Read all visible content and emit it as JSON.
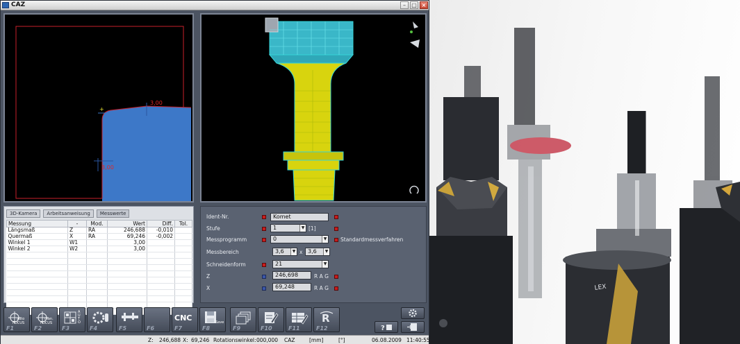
{
  "window": {
    "title": "CAZ"
  },
  "view2d": {
    "dim_top": "3,00",
    "dim_left": "3,00"
  },
  "tabs": [
    {
      "label": "3D-Kamera"
    },
    {
      "label": "Arbeitsanweisung"
    },
    {
      "label": "Messwerte"
    }
  ],
  "table": {
    "headers": [
      "Messung",
      "-",
      "Mod.",
      "Wert",
      "Diff.",
      "Tol."
    ],
    "rows": [
      {
        "messung": "Längsmaß",
        "axis": "Z",
        "mod": "RA",
        "wert": "246,688",
        "diff": "-0,010",
        "tol": ""
      },
      {
        "messung": "Quermaß",
        "axis": "X",
        "mod": "RA",
        "wert": "69,246",
        "diff": "-0,002",
        "tol": ""
      },
      {
        "messung": "Winkel 1",
        "axis": "W1",
        "mod": "",
        "wert": "3,00",
        "diff": "",
        "tol": ""
      },
      {
        "messung": "Winkel 2",
        "axis": "W2",
        "mod": "",
        "wert": "3,00",
        "diff": "",
        "tol": ""
      }
    ]
  },
  "params": {
    "ident_label": "Ident-Nr.",
    "ident_value": "Komet",
    "stufe_label": "Stufe",
    "stufe_value": "1",
    "stufe_count": "[1]",
    "messprogramm_label": "Messprogramm",
    "messprogramm_value": "0",
    "messprogramm_text": "Standardmessverfahren",
    "messbereich_label": "Messbereich",
    "messbereich_a": "3,6",
    "messbereich_x": "x",
    "messbereich_b": "3,6",
    "schneidenform_label": "Schneidenform",
    "schneidenform_value": "21",
    "z_label": "Z",
    "z_value": "246,698",
    "z_rag": "R A G",
    "x_label": "X",
    "x_value": "69,248",
    "x_rag": "R A G"
  },
  "fkeys": [
    {
      "label": "F1",
      "sub1": "auto",
      "sub2": "FOCUS",
      "icon": "crosshair-icon"
    },
    {
      "label": "F2",
      "sub1": "man.",
      "sub2": "FOCUS",
      "icon": "crosshair-icon"
    },
    {
      "label": "F3",
      "sub1": "A U T O",
      "sub2": "",
      "icon": "grid-icon"
    },
    {
      "label": "F4",
      "sub1": "",
      "sub2": "",
      "icon": "tool-insert-icon"
    },
    {
      "label": "F5",
      "sub1": "",
      "sub2": "",
      "icon": "caliper-icon"
    },
    {
      "label": "F6",
      "sub1": "",
      "sub2": "",
      "icon": ""
    },
    {
      "label": "F7",
      "sub1": "CNC",
      "sub2": "",
      "icon": "cnc-icon"
    },
    {
      "label": "F8",
      "sub1": "Save",
      "sub2": "",
      "icon": "save-icon"
    },
    {
      "label": "F9",
      "sub1": "",
      "sub2": "",
      "icon": "layers-icon"
    },
    {
      "label": "F10",
      "sub1": "",
      "sub2": "",
      "icon": "edit-icon"
    },
    {
      "label": "F11",
      "sub1": "",
      "sub2": "",
      "icon": "table-edit-icon"
    },
    {
      "label": "F12",
      "sub1": "",
      "sub2": "",
      "icon": "r-tool-icon"
    }
  ],
  "status": {
    "z_label": "Z:",
    "z_value": "246,688",
    "x_label": "X:",
    "x_value": "69,246",
    "rot_label": "Rotationswinkel:",
    "rot_value": "000,000",
    "app": "CAZ",
    "unit": "[mm]",
    "angle_unit": "[°]",
    "date": "06.08.2009",
    "time": "11:40:55"
  },
  "colors": {
    "window_bg": "#4c5462",
    "blade_blue": "#3d78c8",
    "tool_yellow": "#d8d40e",
    "wire_cyan": "#35d3d8",
    "marker_red": "#c81c1c"
  }
}
